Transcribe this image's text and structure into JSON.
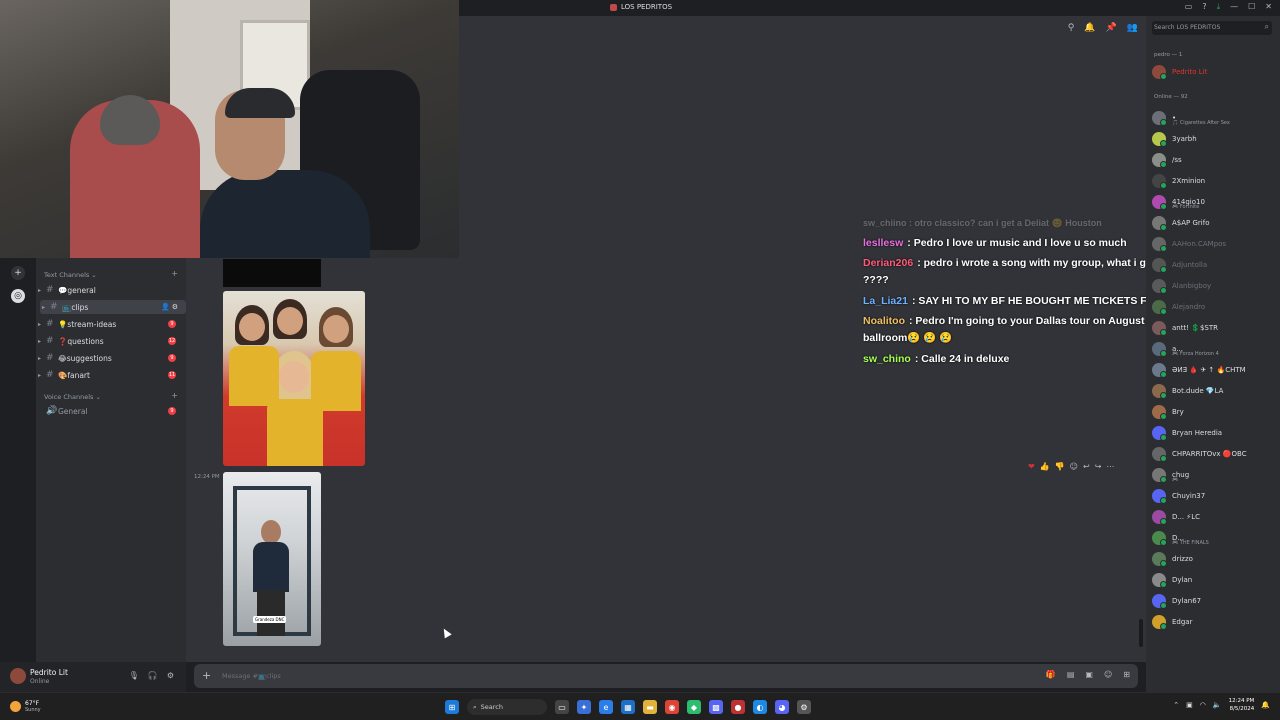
{
  "window": {
    "title": "LOS PEDRITOS",
    "controls": [
      "—",
      "☐",
      "✕"
    ]
  },
  "channels": {
    "text_category": "Text Channels",
    "voice_category": "Voice Channels",
    "items": [
      {
        "label": "💬general",
        "badge": ""
      },
      {
        "label": "📺clips",
        "badge": ""
      },
      {
        "label": "💡stream-ideas",
        "badge": "9"
      },
      {
        "label": "❓questions",
        "badge": "12"
      },
      {
        "label": "😂suggestions",
        "badge": "9"
      },
      {
        "label": "🎨fanart",
        "badge": "11"
      }
    ],
    "voice": {
      "label": "General",
      "badge": "9"
    }
  },
  "user_panel": {
    "name": "Pedrito Lit",
    "status": "Online"
  },
  "main": {
    "timestamp": "12:24 PM",
    "image_caption": "Grandeza DNC",
    "composer_placeholder": "Message #📺clips",
    "message_actions": [
      "❤",
      "👍",
      "👎",
      "☺",
      "↩",
      "↪",
      "⋯"
    ],
    "header_icons": [
      "⚲",
      "🔔",
      "📌",
      "👥"
    ]
  },
  "overlay": {
    "faded_line": "sw_chiino : otro classico? can i get a Deliat 😊 Houston",
    "lines": [
      {
        "user": "lesllesw",
        "color": "#e870e0",
        "text": ": Pedro I love ur music and I love u so much"
      },
      {
        "user": "Derian206",
        "color": "#ff5a7a",
        "text": ": pedro i wrote a song with my group, what i gotta do for u to listen to it ????"
      },
      {
        "user": "La_Lia21",
        "color": "#6fb0ff",
        "text": ": SAY HI TO MY BF HE BOUGHT ME TICKETS FOR UR CONCERT"
      },
      {
        "user": "Noalitoo",
        "color": "#f0c060",
        "text": ": Pedro I'm going to your Dallas tour on August 21 at the south side ballroom😢 😢 😢"
      },
      {
        "user": "sw_chino",
        "color": "#a5ff52",
        "text": ": Calle 24 in deluxe"
      }
    ]
  },
  "members": {
    "search_placeholder": "Search LOS PEDRITOS",
    "group_pedro": "pedro — 1",
    "group_online": "Online — 92",
    "owner": {
      "name": "Pedrito Lit",
      "color": "#e0362e"
    },
    "list": [
      {
        "name": "•",
        "sub": "🎵 Cigarettes After Sex",
        "color": "#6d6f78"
      },
      {
        "name": "3yarbh",
        "sub": "",
        "color": "#b6c94a"
      },
      {
        "name": "/ss",
        "sub": "",
        "color": "#8b8f8a"
      },
      {
        "name": "2Xminion",
        "sub": "",
        "color": "#444"
      },
      {
        "name": "414gio10",
        "sub": "🎮 Fortnite",
        "color": "#b04ab0"
      },
      {
        "name": "A$AP Grifo",
        "sub": "",
        "color": "#777"
      },
      {
        "name": "AAHon.CAMpos",
        "sub": "",
        "color": "#666"
      },
      {
        "name": "Adjuntolla",
        "sub": "",
        "color": "#555"
      },
      {
        "name": "Alanbigboy",
        "sub": "",
        "color": "#5a5a5a"
      },
      {
        "name": "Alejandro",
        "sub": "",
        "color": "#4a6a4a"
      },
      {
        "name": "antt! 💲$STR",
        "sub": "",
        "color": "#7a5a5a"
      },
      {
        "name": "a...",
        "sub": "🎮 Forza Horizon 4",
        "color": "#5a6a7a"
      },
      {
        "name": "ƏИƎ 🩸 ✈ ↑ 🔥CHTM",
        "sub": "",
        "color": "#6a7a8a"
      },
      {
        "name": "Bot.dude 💎LA",
        "sub": "",
        "color": "#8a6a4a"
      },
      {
        "name": "Bry",
        "sub": "",
        "color": "#a06a4a"
      },
      {
        "name": "Bryan Heredia",
        "sub": "",
        "color": "#5865f2"
      },
      {
        "name": "CHPARRITOvx 🔴OBC",
        "sub": "",
        "color": "#666"
      },
      {
        "name": "chug",
        "sub": "🎮",
        "color": "#777"
      },
      {
        "name": "Chuyin37",
        "sub": "",
        "color": "#5865f2"
      },
      {
        "name": "D... ⚡LC",
        "sub": "",
        "color": "#9a4aa0"
      },
      {
        "name": "D...",
        "sub": "🎮 THE FINALS",
        "color": "#4a8a4a"
      },
      {
        "name": "drizzo",
        "sub": "",
        "color": "#5a7a5a"
      },
      {
        "name": "Dylan",
        "sub": "",
        "color": "#8a8a8a"
      },
      {
        "name": "Dylan67",
        "sub": "",
        "color": "#5865f2"
      },
      {
        "name": "Edgar",
        "sub": "",
        "color": "#d0a02a"
      }
    ]
  },
  "taskbar": {
    "weather_temp": "67°F",
    "weather_desc": "Sunny",
    "search_label": "Search",
    "time": "12:24 PM",
    "date": "8/5/2024"
  }
}
